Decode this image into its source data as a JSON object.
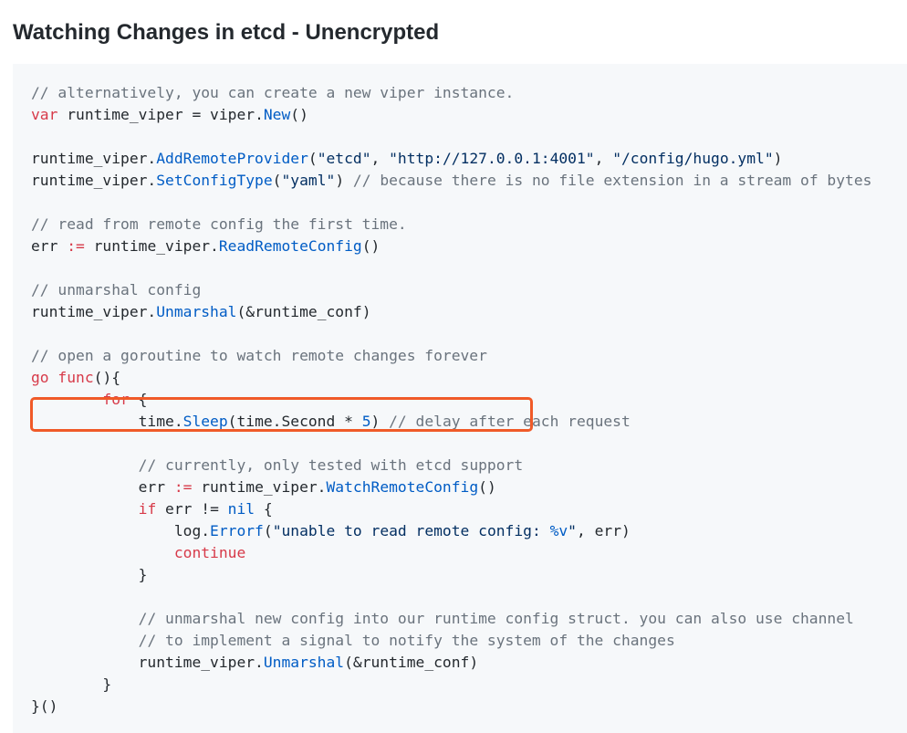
{
  "page": {
    "heading": "Watching Changes in etcd - Unencrypted"
  },
  "colors": {
    "background": "#ffffff",
    "code_background": "#f6f8fa",
    "comment": "#6a737d",
    "keyword": "#d73a49",
    "function": "#005cc5",
    "string": "#032f62",
    "number": "#005cc5",
    "plain": "#24292e",
    "highlight_border": "#f05a28"
  },
  "code": {
    "language": "go",
    "highlighted_line": 12,
    "lines": [
      [
        {
          "t": "comment",
          "v": "// alternatively, you can create a new viper instance."
        }
      ],
      [
        {
          "t": "keyword",
          "v": "var"
        },
        {
          "t": "plain",
          "v": " runtime_viper = viper."
        },
        {
          "t": "func",
          "v": "New"
        },
        {
          "t": "plain",
          "v": "()"
        }
      ],
      [],
      [
        {
          "t": "plain",
          "v": "runtime_viper."
        },
        {
          "t": "func",
          "v": "AddRemoteProvider"
        },
        {
          "t": "plain",
          "v": "("
        },
        {
          "t": "string",
          "v": "\"etcd\""
        },
        {
          "t": "plain",
          "v": ", "
        },
        {
          "t": "string",
          "v": "\"http://127.0.0.1:4001\""
        },
        {
          "t": "plain",
          "v": ", "
        },
        {
          "t": "string",
          "v": "\"/config/hugo.yml\""
        },
        {
          "t": "plain",
          "v": ")"
        }
      ],
      [
        {
          "t": "plain",
          "v": "runtime_viper."
        },
        {
          "t": "func",
          "v": "SetConfigType"
        },
        {
          "t": "plain",
          "v": "("
        },
        {
          "t": "string",
          "v": "\"yaml\""
        },
        {
          "t": "plain",
          "v": ") "
        },
        {
          "t": "comment",
          "v": "// because there is no file extension in a stream of bytes"
        }
      ],
      [],
      [
        {
          "t": "comment",
          "v": "// read from remote config the first time."
        }
      ],
      [
        {
          "t": "plain",
          "v": "err "
        },
        {
          "t": "keyword",
          "v": ":="
        },
        {
          "t": "plain",
          "v": " runtime_viper."
        },
        {
          "t": "func",
          "v": "ReadRemoteConfig"
        },
        {
          "t": "plain",
          "v": "()"
        }
      ],
      [],
      [
        {
          "t": "comment",
          "v": "// unmarshal config"
        }
      ],
      [
        {
          "t": "plain",
          "v": "runtime_viper."
        },
        {
          "t": "func",
          "v": "Unmarshal"
        },
        {
          "t": "plain",
          "v": "(&runtime_conf)"
        }
      ],
      [],
      [
        {
          "t": "comment",
          "v": "// open a goroutine to watch remote changes forever"
        }
      ],
      [
        {
          "t": "keyword",
          "v": "go"
        },
        {
          "t": "plain",
          "v": " "
        },
        {
          "t": "keyword",
          "v": "func"
        },
        {
          "t": "plain",
          "v": "(){"
        }
      ],
      [
        {
          "t": "plain",
          "v": "        "
        },
        {
          "t": "keyword",
          "v": "for"
        },
        {
          "t": "plain",
          "v": " {"
        }
      ],
      [
        {
          "t": "plain",
          "v": "            time."
        },
        {
          "t": "func",
          "v": "Sleep"
        },
        {
          "t": "plain",
          "v": "(time.Second * "
        },
        {
          "t": "number",
          "v": "5"
        },
        {
          "t": "plain",
          "v": ") "
        },
        {
          "t": "comment",
          "v": "// delay after each request"
        }
      ],
      [],
      [
        {
          "t": "plain",
          "v": "            "
        },
        {
          "t": "comment",
          "v": "// currently, only tested with etcd support"
        }
      ],
      [
        {
          "t": "plain",
          "v": "            err "
        },
        {
          "t": "keyword",
          "v": ":="
        },
        {
          "t": "plain",
          "v": " runtime_viper."
        },
        {
          "t": "func",
          "v": "WatchRemoteConfig"
        },
        {
          "t": "plain",
          "v": "()"
        }
      ],
      [
        {
          "t": "plain",
          "v": "            "
        },
        {
          "t": "keyword",
          "v": "if"
        },
        {
          "t": "plain",
          "v": " err != "
        },
        {
          "t": "func",
          "v": "nil"
        },
        {
          "t": "plain",
          "v": " {"
        }
      ],
      [
        {
          "t": "plain",
          "v": "                log."
        },
        {
          "t": "func",
          "v": "Errorf"
        },
        {
          "t": "plain",
          "v": "("
        },
        {
          "t": "string",
          "v": "\"unable to read remote config: "
        },
        {
          "t": "func",
          "v": "%v"
        },
        {
          "t": "string",
          "v": "\""
        },
        {
          "t": "plain",
          "v": ", err)"
        }
      ],
      [
        {
          "t": "plain",
          "v": "                "
        },
        {
          "t": "keyword",
          "v": "continue"
        }
      ],
      [
        {
          "t": "plain",
          "v": "            }"
        }
      ],
      [],
      [
        {
          "t": "plain",
          "v": "            "
        },
        {
          "t": "comment",
          "v": "// unmarshal new config into our runtime config struct. you can also use channel"
        }
      ],
      [
        {
          "t": "plain",
          "v": "            "
        },
        {
          "t": "comment",
          "v": "// to implement a signal to notify the system of the changes"
        }
      ],
      [
        {
          "t": "plain",
          "v": "            runtime_viper."
        },
        {
          "t": "func",
          "v": "Unmarshal"
        },
        {
          "t": "plain",
          "v": "(&runtime_conf)"
        }
      ],
      [
        {
          "t": "plain",
          "v": "        }"
        }
      ],
      [
        {
          "t": "plain",
          "v": "}()"
        }
      ]
    ]
  }
}
